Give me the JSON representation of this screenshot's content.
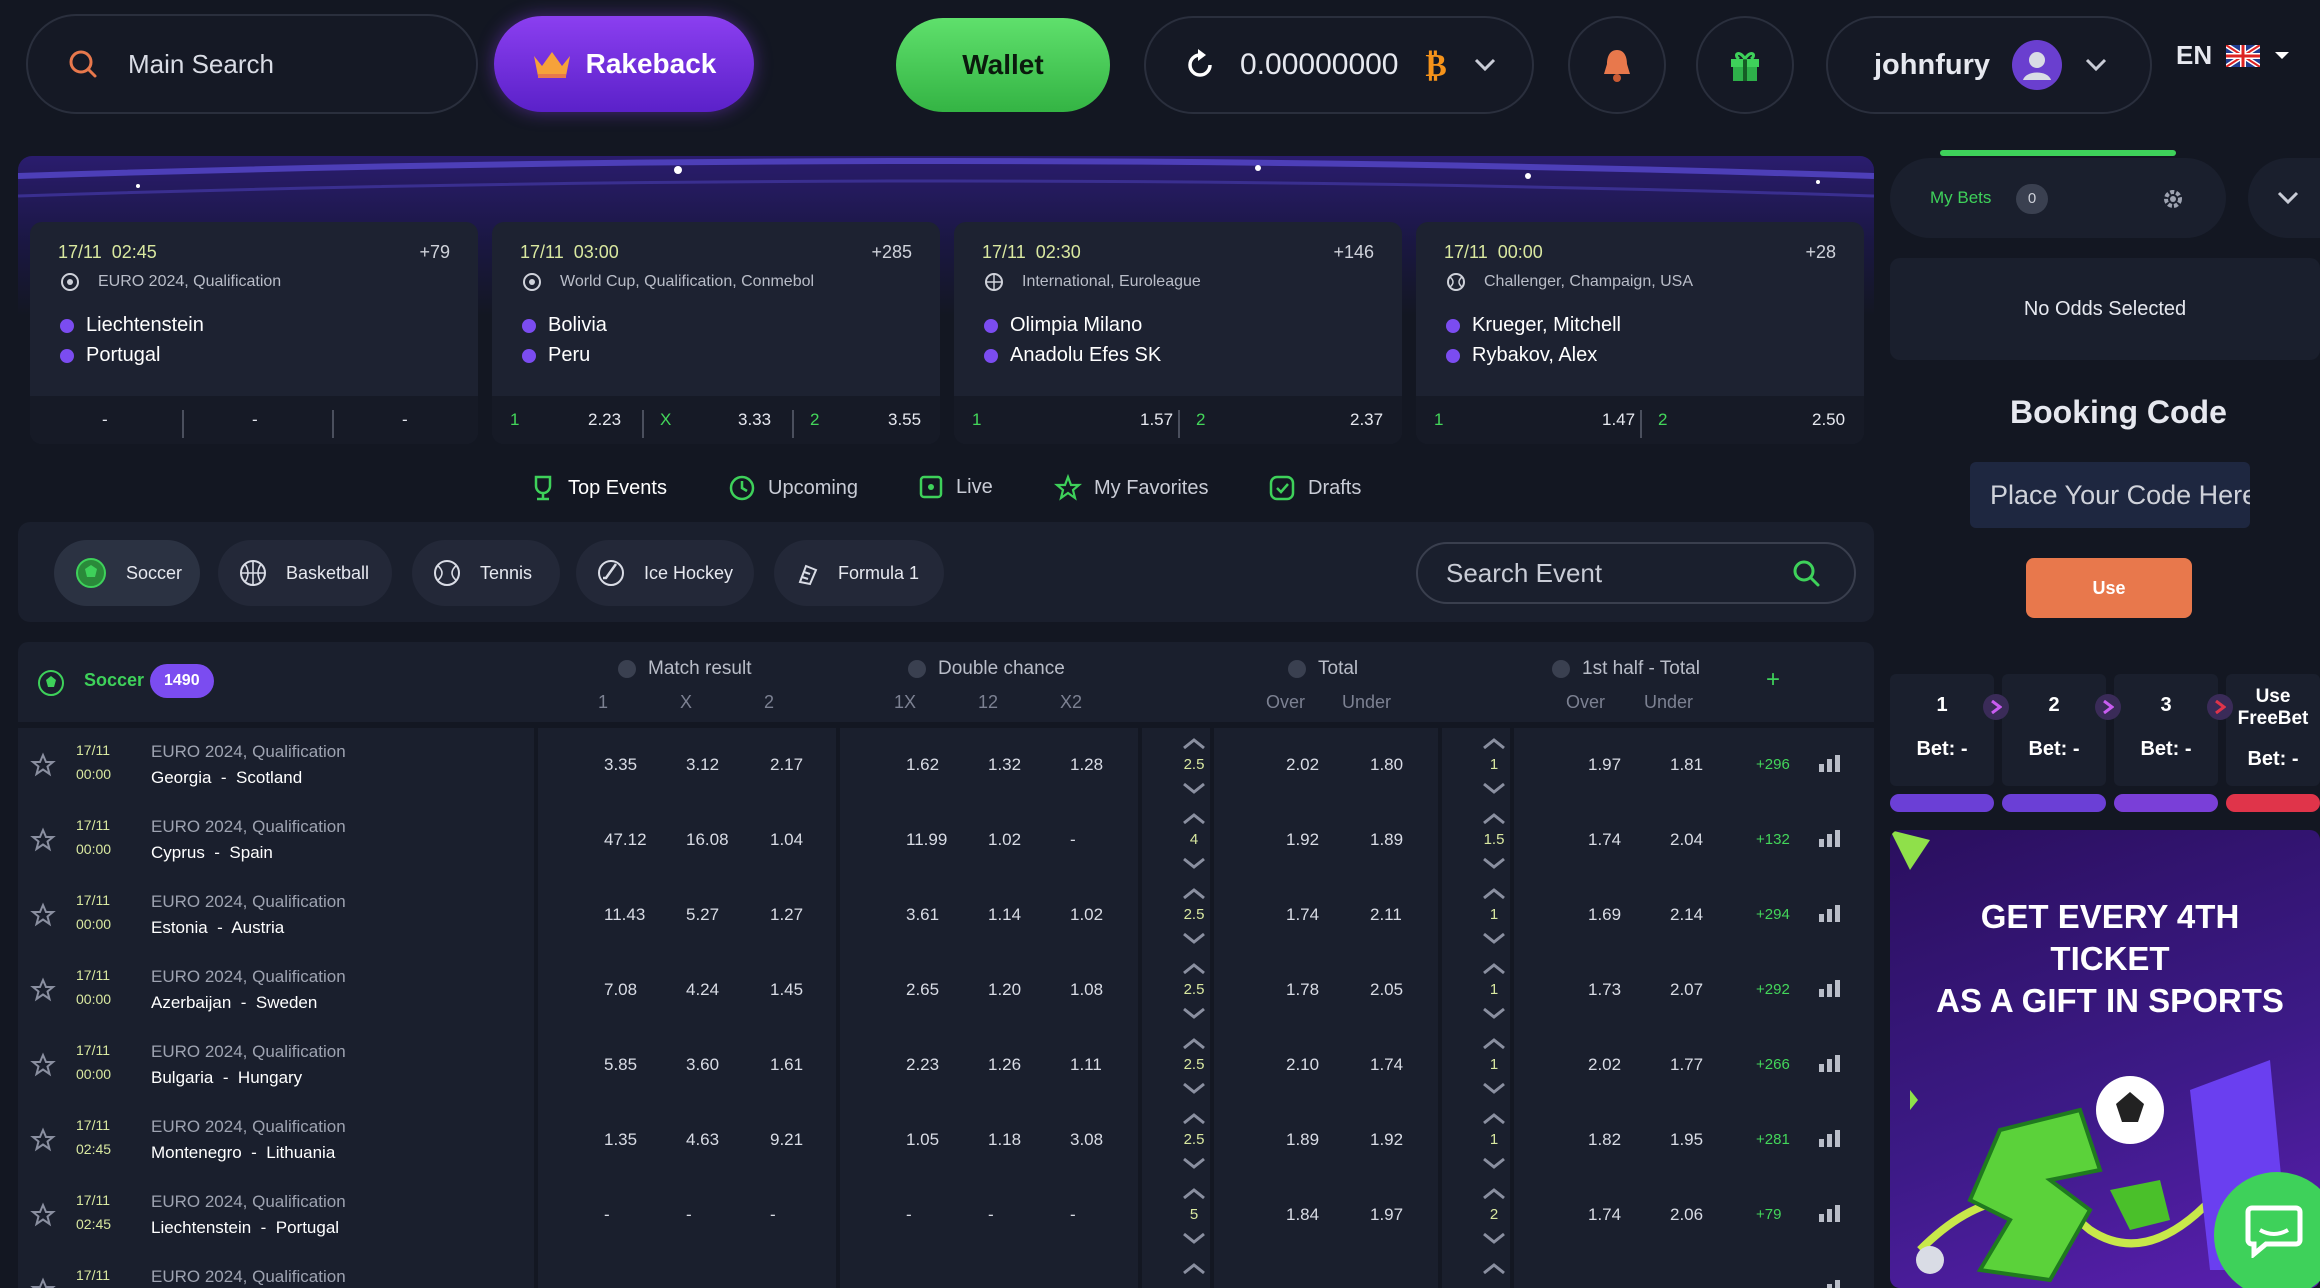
{
  "header": {
    "search_placeholder": "Main Search",
    "rakeback_label": "Rakeback",
    "wallet_label": "Wallet",
    "balance": "0.00000000",
    "username": "johnfury",
    "language": "EN"
  },
  "featured": [
    {
      "date": "17/11",
      "time": "02:45",
      "more": "+79",
      "league": "EURO 2024, Qualification",
      "team1": "Liechtenstein",
      "team2": "Portugal",
      "odds": [
        "-",
        "-",
        "-"
      ]
    },
    {
      "date": "17/11",
      "time": "03:00",
      "more": "+285",
      "league": "World Cup, Qualification, Conmebol",
      "team1": "Bolivia",
      "team2": "Peru",
      "odds": [
        {
          "label": "1",
          "value": "2.23"
        },
        {
          "label": "X",
          "value": "3.33"
        },
        {
          "label": "2",
          "value": "3.55"
        }
      ]
    },
    {
      "date": "17/11",
      "time": "02:30",
      "more": "+146",
      "league": "International, Euroleague",
      "team1": "Olimpia Milano",
      "team2": "Anadolu Efes SK",
      "odds": [
        {
          "label": "1",
          "value": "1.57"
        },
        {
          "label": "2",
          "value": "2.37"
        }
      ]
    },
    {
      "date": "17/11",
      "time": "00:00",
      "more": "+28",
      "league": "Challenger, Champaign, USA",
      "team1": "Krueger, Mitchell",
      "team2": "Rybakov, Alex",
      "odds": [
        {
          "label": "1",
          "value": "1.47"
        },
        {
          "label": "2",
          "value": "2.50"
        }
      ]
    }
  ],
  "tabs": [
    "Top Events",
    "Upcoming",
    "Live",
    "My Favorites",
    "Drafts"
  ],
  "sports": [
    "Soccer",
    "Basketball",
    "Tennis",
    "Ice Hockey",
    "Formula 1"
  ],
  "search_event_placeholder": "Search Event",
  "table": {
    "sport": "Soccer",
    "count": "1490",
    "groups": [
      "Match result",
      "Double chance",
      "Total",
      "1st half - Total"
    ],
    "sub_match": [
      "1",
      "X",
      "2"
    ],
    "sub_double": [
      "1X",
      "12",
      "X2"
    ],
    "sub_total": [
      "Over",
      "Under"
    ],
    "sub_half": [
      "Over",
      "Under"
    ],
    "add": "+",
    "rows": [
      {
        "date": "17/11",
        "time": "00:00",
        "league": "EURO 2024, Qualification",
        "teams": "Georgia  -  Scotland",
        "m1": "3.35",
        "mx": "3.12",
        "m2": "2.17",
        "d1": "1.62",
        "d2": "1.32",
        "d3": "1.28",
        "tl": "2.5",
        "to": "2.02",
        "tu": "1.80",
        "hl": "1",
        "ho": "1.97",
        "hu": "1.81",
        "more": "+296"
      },
      {
        "date": "17/11",
        "time": "00:00",
        "league": "EURO 2024, Qualification",
        "teams": "Cyprus  -  Spain",
        "m1": "47.12",
        "mx": "16.08",
        "m2": "1.04",
        "d1": "11.99",
        "d2": "1.02",
        "d3": "-",
        "tl": "4",
        "to": "1.92",
        "tu": "1.89",
        "hl": "1.5",
        "ho": "1.74",
        "hu": "2.04",
        "more": "+132"
      },
      {
        "date": "17/11",
        "time": "00:00",
        "league": "EURO 2024, Qualification",
        "teams": "Estonia  -  Austria",
        "m1": "11.43",
        "mx": "5.27",
        "m2": "1.27",
        "d1": "3.61",
        "d2": "1.14",
        "d3": "1.02",
        "tl": "2.5",
        "to": "1.74",
        "tu": "2.11",
        "hl": "1",
        "ho": "1.69",
        "hu": "2.14",
        "more": "+294"
      },
      {
        "date": "17/11",
        "time": "00:00",
        "league": "EURO 2024, Qualification",
        "teams": "Azerbaijan  -  Sweden",
        "m1": "7.08",
        "mx": "4.24",
        "m2": "1.45",
        "d1": "2.65",
        "d2": "1.20",
        "d3": "1.08",
        "tl": "2.5",
        "to": "1.78",
        "tu": "2.05",
        "hl": "1",
        "ho": "1.73",
        "hu": "2.07",
        "more": "+292"
      },
      {
        "date": "17/11",
        "time": "00:00",
        "league": "EURO 2024, Qualification",
        "teams": "Bulgaria  -  Hungary",
        "m1": "5.85",
        "mx": "3.60",
        "m2": "1.61",
        "d1": "2.23",
        "d2": "1.26",
        "d3": "1.11",
        "tl": "2.5",
        "to": "2.10",
        "tu": "1.74",
        "hl": "1",
        "ho": "2.02",
        "hu": "1.77",
        "more": "+266"
      },
      {
        "date": "17/11",
        "time": "02:45",
        "league": "EURO 2024, Qualification",
        "teams": "Montenegro  -  Lithuania",
        "m1": "1.35",
        "mx": "4.63",
        "m2": "9.21",
        "d1": "1.05",
        "d2": "1.18",
        "d3": "3.08",
        "tl": "2.5",
        "to": "1.89",
        "tu": "1.92",
        "hl": "1",
        "ho": "1.82",
        "hu": "1.95",
        "more": "+281"
      },
      {
        "date": "17/11",
        "time": "02:45",
        "league": "EURO 2024, Qualification",
        "teams": "Liechtenstein  -  Portugal",
        "m1": "-",
        "mx": "-",
        "m2": "-",
        "d1": "-",
        "d2": "-",
        "d3": "-",
        "tl": "5",
        "to": "1.84",
        "tu": "1.97",
        "hl": "2",
        "ho": "1.74",
        "hu": "2.06",
        "more": "+79"
      },
      {
        "date": "17/11",
        "time": "",
        "league": "EURO 2024, Qualification",
        "teams": "",
        "m1": "",
        "mx": "",
        "m2": "",
        "d1": "",
        "d2": "",
        "d3": "",
        "tl": "",
        "to": "",
        "tu": "",
        "hl": "",
        "ho": "",
        "hu": "",
        "more": ""
      }
    ]
  },
  "betslip": {
    "tab_label": "My Bets",
    "count": "0",
    "empty_text": "No Odds Selected",
    "booking_title": "Booking Code",
    "booking_placeholder": "Place Your Code Here",
    "use_label": "Use",
    "slots": [
      {
        "n": "1",
        "bet": "Bet: -"
      },
      {
        "n": "2",
        "bet": "Bet: -"
      },
      {
        "n": "3",
        "bet": "Bet: -"
      }
    ],
    "freebet_l1": "Use",
    "freebet_l2": "FreeBet",
    "freebet_bet": "Bet: -"
  },
  "promo": {
    "line1": "GET EVERY 4TH TICKET",
    "line2": "AS A GIFT IN SPORTS"
  },
  "colors": {
    "accent_green": "#3ed15a",
    "accent_purple": "#7b4cf0",
    "date_yellow": "#d9e8a0",
    "use_orange": "#e8784c"
  }
}
